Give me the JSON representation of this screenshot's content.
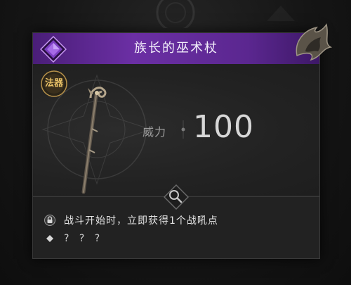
{
  "item": {
    "name": "族长的巫术杖",
    "type_badge": "法器",
    "stat_label": "威力",
    "stat_value": "100",
    "rarity_color": "#6b2fa4"
  },
  "effects": [
    {
      "icon": "lock-icon",
      "text": "战斗开始时，立即获得1个战吼点"
    },
    {
      "icon": "diamond-icon",
      "text": "? ? ?"
    }
  ],
  "colors": {
    "header": "#5b2790",
    "accent_gold": "#e7c067",
    "panel": "#222222"
  }
}
